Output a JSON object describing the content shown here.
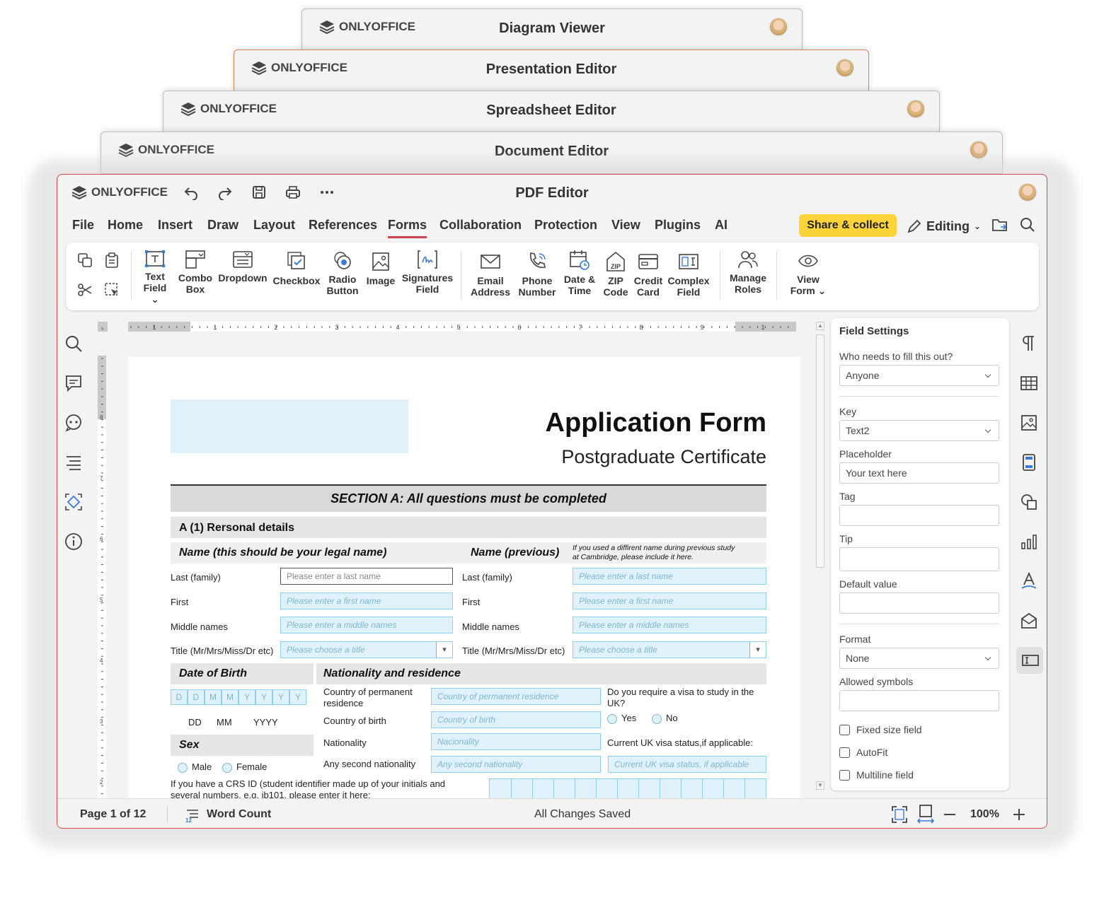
{
  "stacked_windows": [
    {
      "logo": "ONLYOFFICE",
      "title": "Diagram Viewer"
    },
    {
      "logo": "ONLYOFFICE",
      "title": "Presentation Editor"
    },
    {
      "logo": "ONLYOFFICE",
      "title": "Spreadsheet Editor"
    },
    {
      "logo": "ONLYOFFICE",
      "title": "Document Editor"
    }
  ],
  "app": {
    "logo": "ONLYOFFICE",
    "title": "PDF Editor"
  },
  "menu": {
    "tabs": [
      "File",
      "Home",
      "Insert",
      "Draw",
      "Layout",
      "References",
      "Forms",
      "Collaboration",
      "Protection",
      "View",
      "Plugins",
      "AI"
    ],
    "active": "Forms",
    "share": "Share & collect",
    "mode": "Editing"
  },
  "ribbon": {
    "text_field": [
      "Text",
      "Field ⌄"
    ],
    "combo_box": [
      "Combo",
      "Box"
    ],
    "dropdown": "Dropdown",
    "checkbox": "Checkbox",
    "radio": [
      "Radio",
      "Button"
    ],
    "image": "Image",
    "signatures": [
      "Signatures",
      "Field"
    ],
    "email": [
      "Email",
      "Address"
    ],
    "phone": [
      "Phone",
      "Number"
    ],
    "datetime": [
      "Date &",
      "Time"
    ],
    "zip": [
      "ZIP",
      "Code"
    ],
    "credit": [
      "Credit",
      "Card"
    ],
    "complex": [
      "Complex",
      "Field"
    ],
    "roles": [
      "Manage",
      "Roles"
    ],
    "view": [
      "View",
      "Form ⌄"
    ]
  },
  "form": {
    "title": "Application Form",
    "subtitle": "Postgraduate Certificate",
    "section": "SECTION A: All questions must be completed",
    "personal": "A (1) Rersonal details",
    "name_h": "Name (this should be your legal name)",
    "name_prev_h": "Name (previous)",
    "name_prev_note": "If you used a diffirent name during previous study at Cambridge, please include it here.",
    "last": "Last (family)",
    "first": "First",
    "middle": "Middle names",
    "title_lbl": "Title (Mr/Mrs/Miss/Dr etc)",
    "ph_last": "Please enter a last name",
    "ph_first": "Please enter a first name",
    "ph_middle": "Please enter a middle names",
    "ph_title": "Please choose a title",
    "dob_h": "Date of Birth",
    "dob_cells": [
      "D",
      "D",
      "M",
      "M",
      "Y",
      "Y",
      "Y",
      "Y"
    ],
    "dd": "DD",
    "mm": "MM",
    "yyyy": "YYYY",
    "nat_h": "Nationality and residence",
    "cpr": "Country of permanent residence",
    "ph_cpr": "Country of permanent residence",
    "cob": "Country of birth",
    "ph_cob": "Country of birth",
    "nat": "Nationality",
    "ph_nat": "Nacionality",
    "second": "Any second nationality",
    "ph_second": "Any second nationality",
    "visa_q": "Do you require a visa to study in the UK?",
    "yes": "Yes",
    "no": "No",
    "visa_status": "Current UK visa status,if applicable:",
    "ph_visa": "Current UK visa status, if applicable",
    "sex_h": "Sex",
    "male": "Male",
    "female": "Female",
    "crs": "If you have a CRS ID (student identifier made up of your initials and several numbers, e.g. jb101, please enter it here:"
  },
  "field_settings": {
    "title": "Field Settings",
    "who_lbl": "Who needs to fill this out?",
    "who_val": "Anyone",
    "key_lbl": "Key",
    "key_val": "Text2",
    "ph_lbl": "Placeholder",
    "ph_val": "Your text here",
    "tag_lbl": "Tag",
    "tip_lbl": "Tip",
    "default_lbl": "Default value",
    "format_lbl": "Format",
    "format_val": "None",
    "allowed_lbl": "Allowed symbols",
    "fixed": "Fixed size field",
    "autofit": "AutoFit",
    "multiline": "Multiline field"
  },
  "ruler": {
    "h": [
      "1",
      "1",
      "2",
      "3",
      "4",
      "5",
      "6",
      "7",
      "8",
      "9",
      "1"
    ],
    "v": [
      "8",
      "7",
      "6",
      "5",
      "4",
      "3",
      "2",
      "1"
    ]
  },
  "status": {
    "page": "Page 1 of 12",
    "word_count": "Word Count",
    "saved": "All Changes Saved",
    "zoom": "100%"
  }
}
